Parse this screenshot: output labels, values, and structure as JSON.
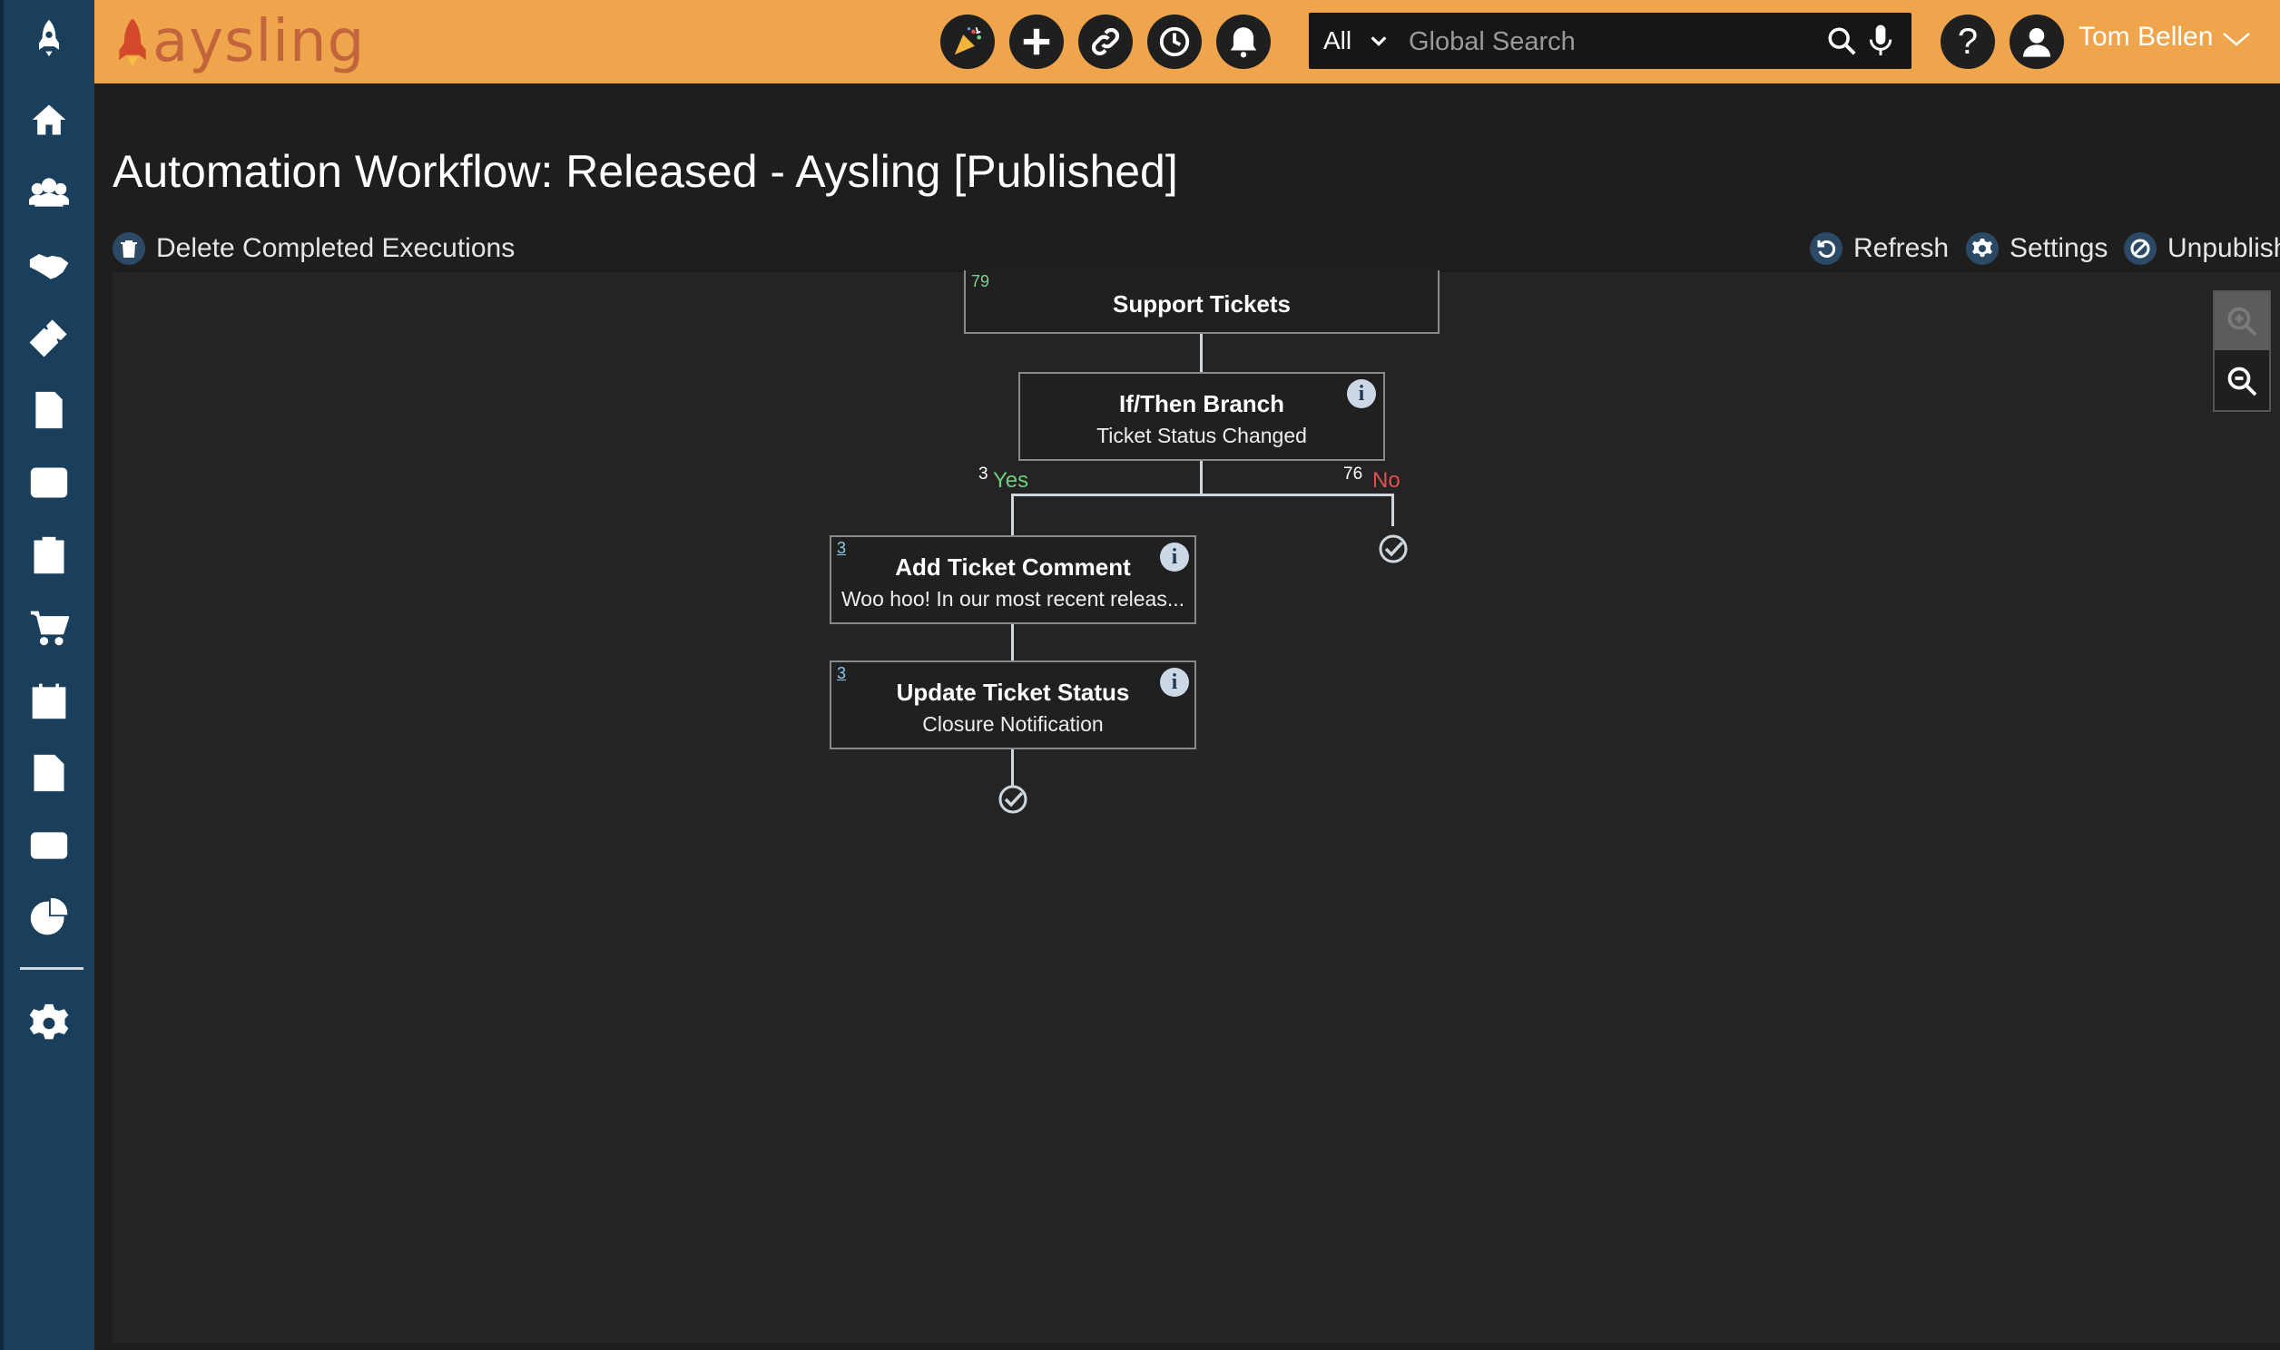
{
  "app": {
    "logo_text": "aysling",
    "accent_color": "#eea54b",
    "sidebar_color": "#1a3f5c"
  },
  "topbar": {
    "icons": [
      "party-popper-icon",
      "plus-icon",
      "link-icon",
      "history-icon",
      "bell-icon"
    ],
    "search": {
      "scope": "All",
      "placeholder": "Global Search"
    },
    "help": "?",
    "user_name": "Tom Bellen"
  },
  "sidebar": {
    "items": [
      "rocket",
      "home",
      "contacts",
      "deals",
      "tickets",
      "invoices",
      "expenses",
      "tasks",
      "cart",
      "events",
      "w2",
      "email",
      "reports",
      "settings"
    ]
  },
  "page": {
    "title": "Automation Workflow: Released - Aysling [Published]",
    "actions": {
      "delete": "Delete Completed Executions",
      "refresh": "Refresh",
      "settings": "Settings",
      "unpublish": "Unpublish"
    }
  },
  "workflow": {
    "trigger": {
      "count": "79",
      "title": "Support Tickets"
    },
    "branch": {
      "title": "If/Then Branch",
      "subtitle": "Ticket Status Changed",
      "info": "i"
    },
    "yes": {
      "count": "3",
      "label": "Yes",
      "color": "#6fcf7c"
    },
    "no": {
      "count": "76",
      "label": "No",
      "color": "#e0524b"
    },
    "comment": {
      "count": "3",
      "title": "Add Ticket Comment",
      "subtitle": "Woo hoo! In our most recent releas...",
      "info": "i"
    },
    "status": {
      "count": "3",
      "title": "Update Ticket Status",
      "subtitle": "Closure Notification",
      "info": "i"
    }
  }
}
